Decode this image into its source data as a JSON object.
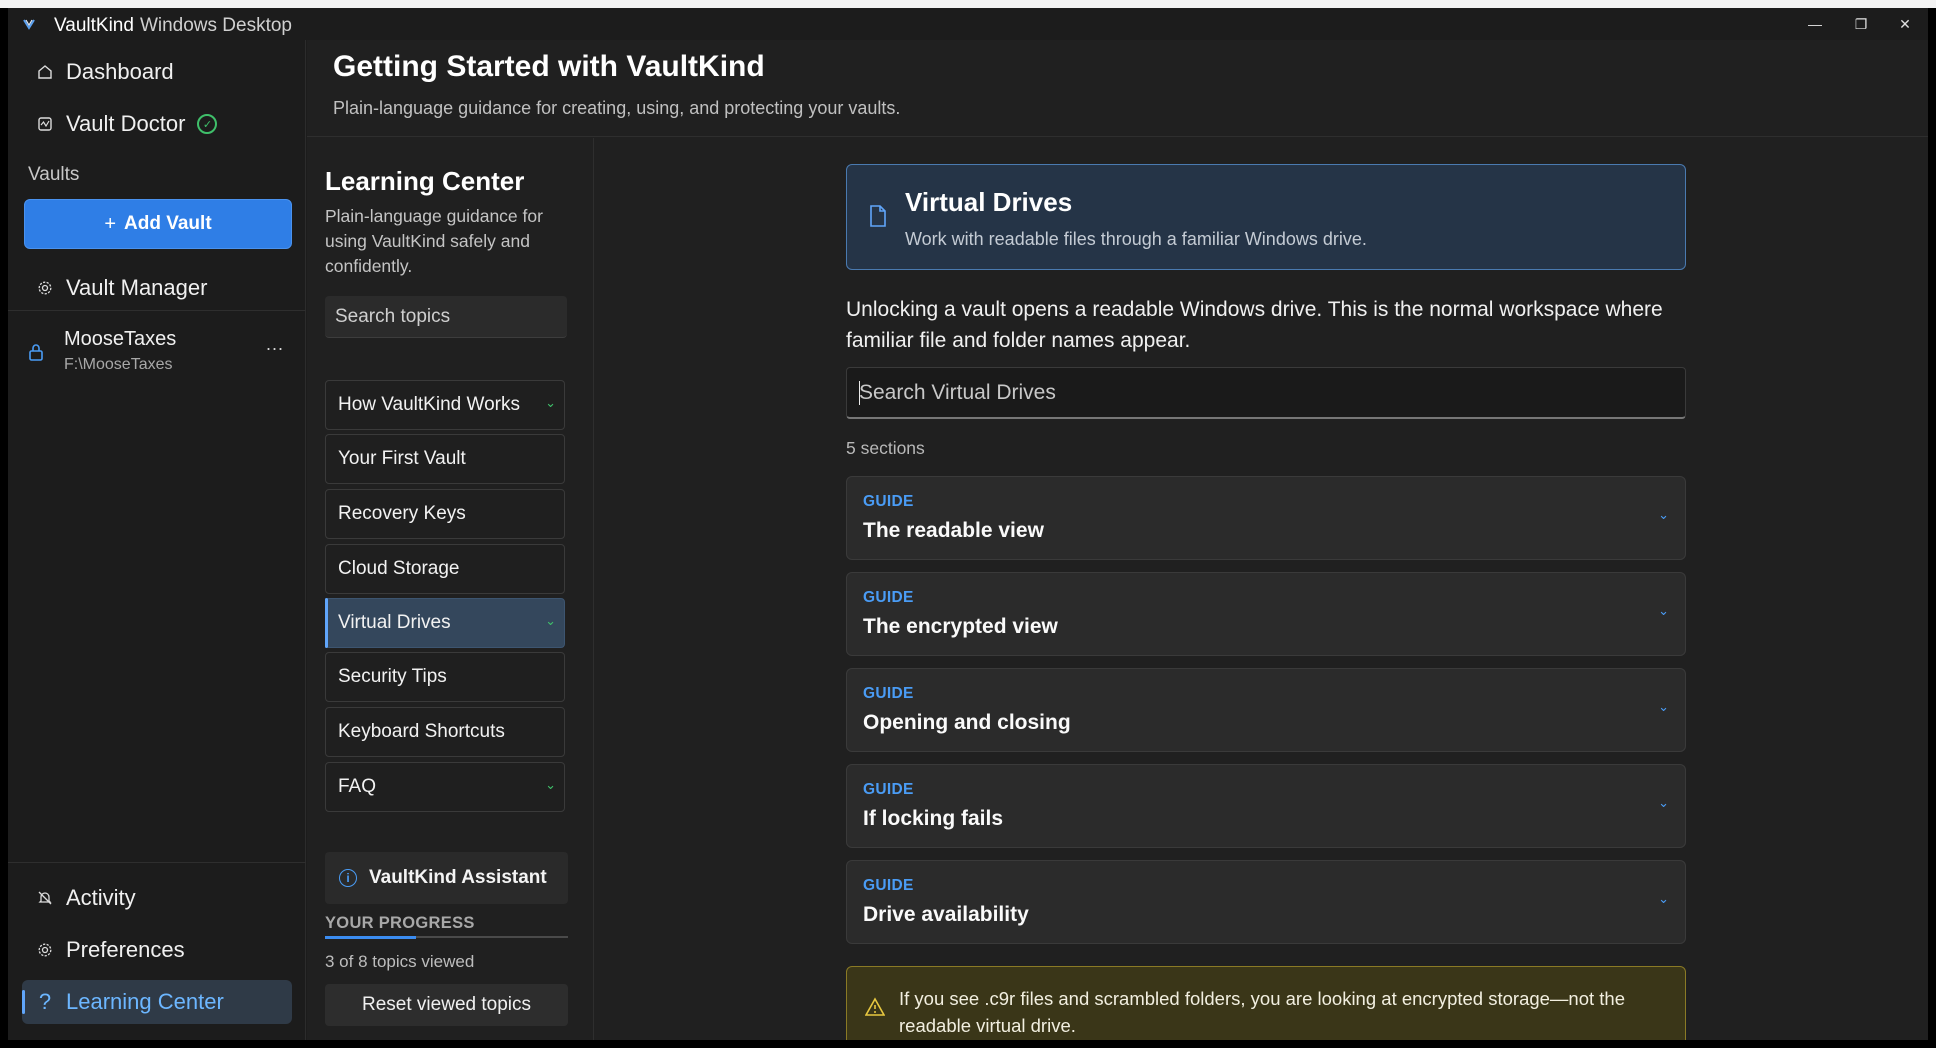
{
  "window": {
    "app_name": "VaultKind",
    "app_type": "Windows Desktop",
    "minimize": "—",
    "maximize": "❐",
    "close": "✕"
  },
  "nav": {
    "dashboard": "Dashboard",
    "vault_doctor": "Vault Doctor",
    "vaults_section": "Vaults",
    "add_vault": "Add Vault",
    "vault_manager": "Vault Manager",
    "vault": {
      "name": "MooseTaxes",
      "path": "F:\\MooseTaxes",
      "more": "..."
    },
    "activity": "Activity",
    "preferences": "Preferences",
    "learning_center": "Learning Center"
  },
  "header": {
    "title": "Getting Started with VaultKind",
    "subtitle": "Plain-language guidance for creating, using, and protecting your vaults."
  },
  "learning": {
    "title": "Learning Center",
    "description": "Plain-language guidance for using VaultKind safely and confidently.",
    "search_placeholder": "Search topics",
    "topics": [
      {
        "label": "How VaultKind Works",
        "expandable": true
      },
      {
        "label": "Your First Vault",
        "expandable": false
      },
      {
        "label": "Recovery Keys",
        "expandable": false
      },
      {
        "label": "Cloud Storage",
        "expandable": false
      },
      {
        "label": "Virtual Drives",
        "expandable": true
      },
      {
        "label": "Security Tips",
        "expandable": false
      },
      {
        "label": "Keyboard Shortcuts",
        "expandable": false
      },
      {
        "label": "FAQ",
        "expandable": true
      }
    ],
    "assistant": "VaultKind Assistant",
    "progress_label": "YOUR PROGRESS",
    "progress_fraction": 0.375,
    "progress_text": "3 of 8 topics viewed",
    "reset": "Reset viewed topics"
  },
  "content": {
    "hero_title": "Virtual Drives",
    "hero_subtitle": "Work with readable files through a familiar Windows drive.",
    "intro": "Unlocking a vault opens a readable Windows drive. This is the normal workspace where familiar file and folder names appear.",
    "search_placeholder": "Search Virtual Drives",
    "section_count": "5 sections",
    "sections": [
      {
        "tag": "GUIDE",
        "title": "The readable view"
      },
      {
        "tag": "GUIDE",
        "title": "The encrypted view"
      },
      {
        "tag": "GUIDE",
        "title": "Opening and closing"
      },
      {
        "tag": "GUIDE",
        "title": "If locking fails"
      },
      {
        "tag": "GUIDE",
        "title": "Drive availability"
      }
    ],
    "warning": "If you see .c9r files and scrambled folders, you are looking at encrypted storage—not the readable virtual drive."
  },
  "colors": {
    "accent": "#2f7ee6",
    "link_blue": "#4a9cf5",
    "success_green": "#3fbf6a",
    "warning_border": "#8a7a25"
  }
}
